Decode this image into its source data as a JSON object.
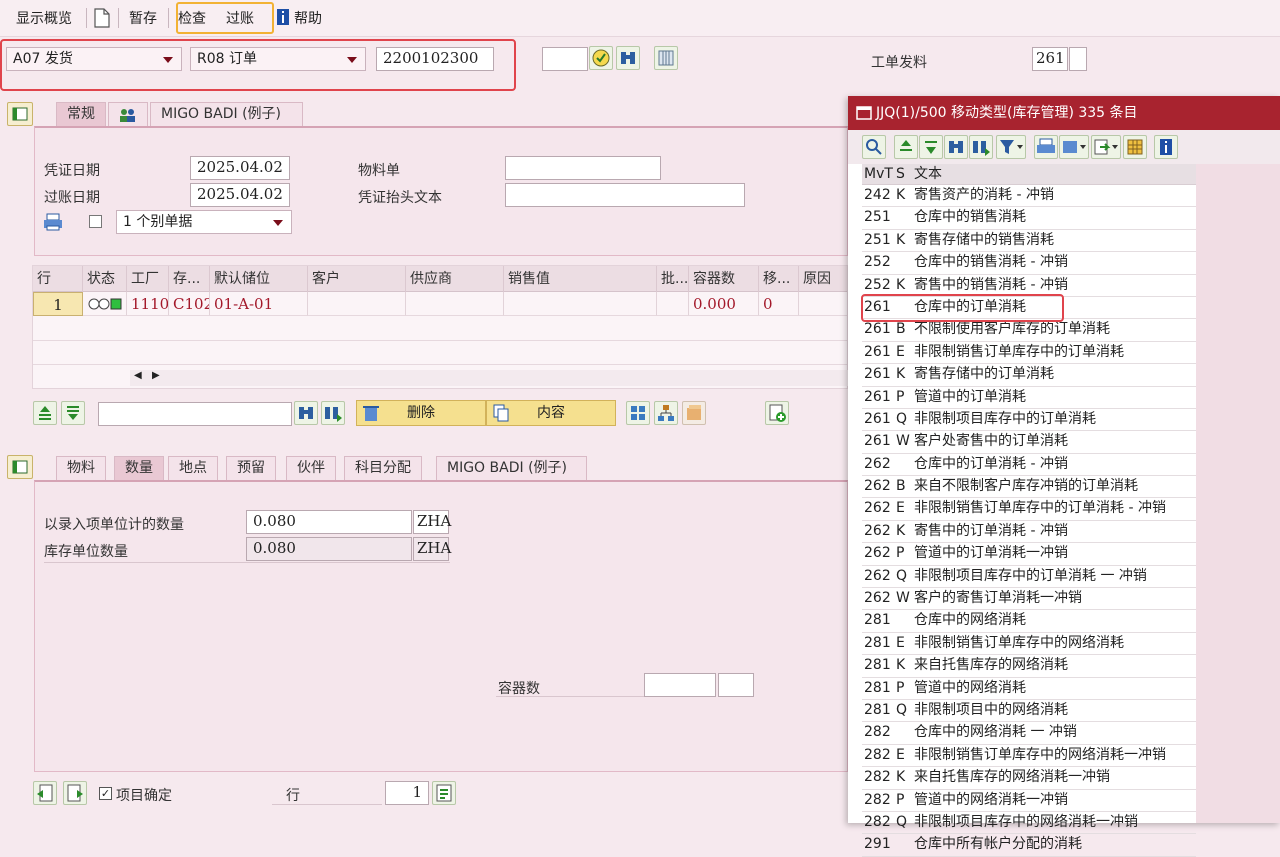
{
  "toolbar": {
    "overview": "显示概览",
    "hold": "暂存",
    "check": "检查",
    "post": "过账",
    "help": "帮助"
  },
  "header": {
    "action": "A07 发货",
    "reference": "R08 订单",
    "order_number": "2200102300",
    "movement_label": "工单发料",
    "movement_type": "261"
  },
  "tabs_header": {
    "general": "常规",
    "badi": "MIGO BADI (例子)"
  },
  "general": {
    "doc_date_label": "凭证日期",
    "doc_date": "2025.04.02",
    "post_date_label": "过账日期",
    "post_date": "2025.04.02",
    "material_slip_label": "物料单",
    "material_slip": "",
    "header_text_label": "凭证抬头文本",
    "header_text": "",
    "slip_option": "1 个别单据"
  },
  "grid": {
    "columns": [
      "行",
      "状态",
      "工厂",
      "存...",
      "默认储位",
      "客户",
      "供应商",
      "销售值",
      "批...",
      "容器数",
      "移...",
      "原因"
    ],
    "row": {
      "line": "1",
      "plant": "1110",
      "sloc": "C102",
      "bin": "01-A-01",
      "containers": "0.000",
      "mvt": "0"
    }
  },
  "item_toolbar": {
    "delete": "删除",
    "contents": "内容",
    "search_value": ""
  },
  "tabs_detail": {
    "material": "物料",
    "quantity": "数量",
    "location": "地点",
    "reservation": "预留",
    "partner": "伙伴",
    "account": "科目分配",
    "badi": "MIGO BADI (例子)"
  },
  "quantity": {
    "entry_label": "以录入项单位计的数量",
    "entry_value": "0.080",
    "entry_unit": "ZHA",
    "stock_label": "库存单位数量",
    "stock_value": "0.080",
    "stock_unit": "ZHA",
    "containers_label": "容器数"
  },
  "footer": {
    "item_ok": "项目确定",
    "line_label": "行",
    "line_value": "1"
  },
  "popup": {
    "title": "JJQ(1)/500 移动类型(库存管理) 335 条目",
    "col_mvt": "MvT",
    "col_s": "S",
    "col_text": "文本",
    "rows": [
      {
        "mvt": "242",
        "s": "K",
        "text": "寄售资产的消耗 - 冲销"
      },
      {
        "mvt": "251",
        "s": "",
        "text": "仓库中的销售消耗"
      },
      {
        "mvt": "251",
        "s": "K",
        "text": "寄售存储中的销售消耗"
      },
      {
        "mvt": "252",
        "s": "",
        "text": "仓库中的销售消耗 - 冲销"
      },
      {
        "mvt": "252",
        "s": "K",
        "text": "寄售中的销售消耗 - 冲销"
      },
      {
        "mvt": "261",
        "s": "",
        "text": "仓库中的订单消耗"
      },
      {
        "mvt": "261",
        "s": "B",
        "text": "不限制使用客户库存的订单消耗"
      },
      {
        "mvt": "261",
        "s": "E",
        "text": "非限制销售订单库存中的订单消耗"
      },
      {
        "mvt": "261",
        "s": "K",
        "text": "寄售存储中的订单消耗"
      },
      {
        "mvt": "261",
        "s": "P",
        "text": "管道中的订单消耗"
      },
      {
        "mvt": "261",
        "s": "Q",
        "text": "非限制项目库存中的订单消耗"
      },
      {
        "mvt": "261",
        "s": "W",
        "text": "客户处寄售中的订单消耗"
      },
      {
        "mvt": "262",
        "s": "",
        "text": "仓库中的订单消耗 - 冲销"
      },
      {
        "mvt": "262",
        "s": "B",
        "text": "来自不限制客户库存冲销的订单消耗"
      },
      {
        "mvt": "262",
        "s": "E",
        "text": "非限制销售订单库存中的订单消耗 - 冲销"
      },
      {
        "mvt": "262",
        "s": "K",
        "text": "寄售中的订单消耗 - 冲销"
      },
      {
        "mvt": "262",
        "s": "P",
        "text": "管道中的订单消耗一冲销"
      },
      {
        "mvt": "262",
        "s": "Q",
        "text": "非限制项目库存中的订单消耗 一 冲销"
      },
      {
        "mvt": "262",
        "s": "W",
        "text": "客户的寄售订单消耗一冲销"
      },
      {
        "mvt": "281",
        "s": "",
        "text": "仓库中的网络消耗"
      },
      {
        "mvt": "281",
        "s": "E",
        "text": "非限制销售订单库存中的网络消耗"
      },
      {
        "mvt": "281",
        "s": "K",
        "text": "来自托售库存的网络消耗"
      },
      {
        "mvt": "281",
        "s": "P",
        "text": "管道中的网络消耗"
      },
      {
        "mvt": "281",
        "s": "Q",
        "text": "非限制项目中的网络消耗"
      },
      {
        "mvt": "282",
        "s": "",
        "text": "仓库中的网络消耗 一 冲销"
      },
      {
        "mvt": "282",
        "s": "E",
        "text": "非限制销售订单库存中的网络消耗一冲销"
      },
      {
        "mvt": "282",
        "s": "K",
        "text": "来自托售库存的网络消耗一冲销"
      },
      {
        "mvt": "282",
        "s": "P",
        "text": "管道中的网络消耗一冲销"
      },
      {
        "mvt": "282",
        "s": "Q",
        "text": "非限制项目库存中的网络消耗一冲销"
      },
      {
        "mvt": "291",
        "s": "",
        "text": "仓库中所有帐户分配的消耗"
      }
    ]
  }
}
